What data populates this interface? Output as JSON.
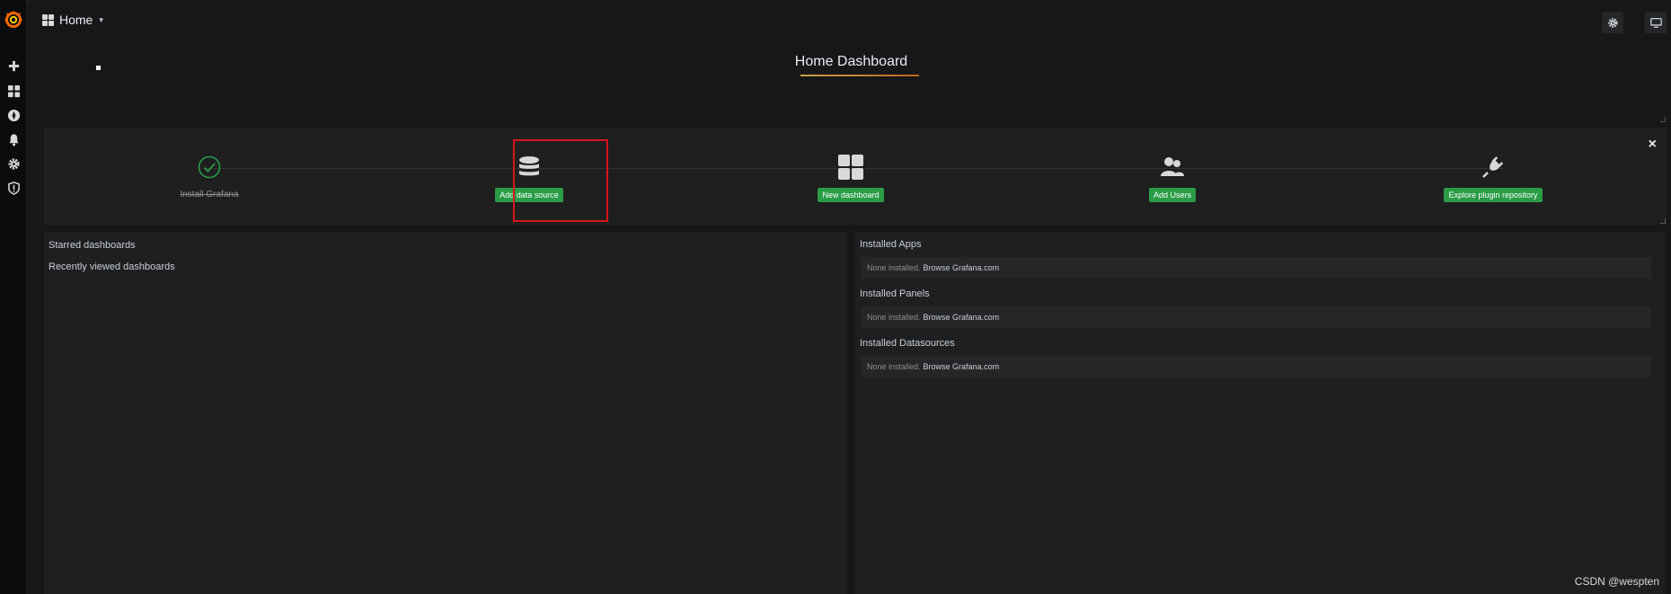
{
  "navbar": {
    "home_label": "Home",
    "caret": "▾"
  },
  "sidebar": {
    "items": [
      {
        "name": "create",
        "icon": "plus-icon"
      },
      {
        "name": "dashboards",
        "icon": "dashboards-icon"
      },
      {
        "name": "explore",
        "icon": "compass-icon"
      },
      {
        "name": "alerting",
        "icon": "bell-icon"
      },
      {
        "name": "configuration",
        "icon": "gear-icon"
      },
      {
        "name": "server-admin",
        "icon": "shield-icon"
      }
    ]
  },
  "title_panel": {
    "title": "Home Dashboard"
  },
  "getting_started": {
    "close": "×",
    "steps": [
      {
        "label": "Install Grafana",
        "done": true,
        "icon": "check-circle-icon"
      },
      {
        "label": "Add data source",
        "done": false,
        "icon": "database-icon"
      },
      {
        "label": "New dashboard",
        "done": false,
        "icon": "dashboard-grid-icon"
      },
      {
        "label": "Add Users",
        "done": false,
        "icon": "users-icon"
      },
      {
        "label": "Explore plugin repository",
        "done": false,
        "icon": "plug-icon"
      }
    ]
  },
  "dashboards_panel": {
    "starred": "Starred dashboards",
    "recent": "Recently viewed dashboards"
  },
  "plugins_panel": {
    "sections": [
      {
        "title": "Installed Apps",
        "none_text": "None installed.",
        "link": "Browse Grafana.com"
      },
      {
        "title": "Installed Panels",
        "none_text": "None installed.",
        "link": "Browse Grafana.com"
      },
      {
        "title": "Installed Datasources",
        "none_text": "None installed.",
        "link": "Browse Grafana.com"
      }
    ]
  },
  "watermark": "CSDN @wespten",
  "colors": {
    "accent_green": "#299c46",
    "highlight_red": "#d8161a",
    "logo_orange": "#f46800"
  }
}
